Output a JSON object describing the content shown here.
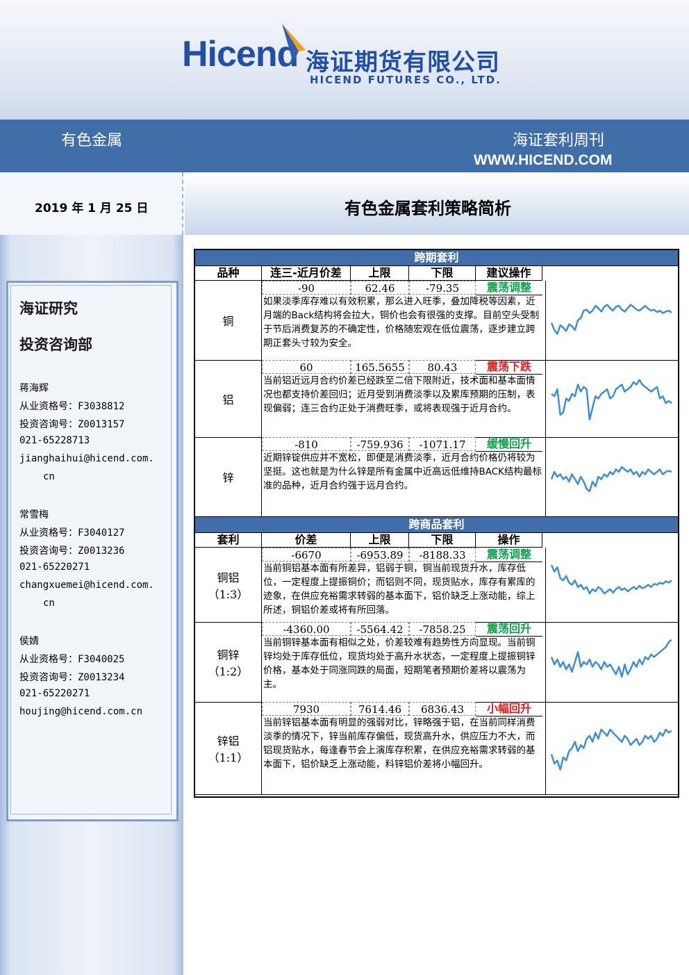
{
  "header": {
    "logo_text": "Hicend",
    "company_cn": "海证期货有限公司",
    "company_en": "HICEND  FUTURES  CO.,  LTD.",
    "section": "有色金属",
    "publication": "海证套利周刊",
    "url": "WWW.HICEND.COM"
  },
  "date": "2019 年 1 月 25 日",
  "doc_title": "有色金属套利策略简析",
  "sidebar": {
    "dept_line1": "海证研究",
    "dept_line2": "投资咨询部",
    "analysts": [
      {
        "name": "蒋海辉",
        "qual": "从业资格号：F3038812",
        "invest": "投资咨询号：Z0013157",
        "phone": "021-65228713",
        "email": "jianghaihui@hicend.com.",
        "email2": "cn"
      },
      {
        "name": "常雪梅",
        "qual": "从业资格号：F3040127",
        "invest": "投资咨询号：Z0013236",
        "phone": "021-65220271",
        "email": "changxuemei@hicend.com.",
        "email2": "cn"
      },
      {
        "name": "侯婧",
        "qual": "从业资格号：F3040025",
        "invest": "投资咨询号：Z0013234",
        "phone": "021-65220271",
        "email": "houjing@hicend.com.cn",
        "email2": ""
      }
    ]
  },
  "colors": {
    "accent": "#3f6ea8",
    "green": "#0aa34a",
    "red": "#e21b1b",
    "line": "#3a8fd6"
  },
  "table": {
    "section1": "跨期套利",
    "headers1": [
      "品种",
      "连三-近月价差",
      "上限",
      "下限",
      "建议操作"
    ],
    "section2": "跨商品套利",
    "headers2": [
      "套利",
      "价差",
      "上限",
      "下限",
      "操作"
    ],
    "rows1": [
      {
        "name": "铜",
        "name2": "",
        "spread": "-90",
        "upper": "62.46",
        "lower": "-79.35",
        "op": "震荡调整",
        "op_color": "green",
        "desc": "如果淡季库存难以有效积累，那么进入旺季，叠加降税等因素，近月端的Back结构将会拉大，铜价也会有很强的支撑。目前空头受制于节后消费复苏的不确定性，价格随宏观在低位震荡，逐步建立跨期正套头寸较为安全。",
        "trend": [
          0.55,
          0.7,
          0.78,
          0.6,
          0.65,
          0.72,
          0.58,
          0.62,
          0.7,
          0.5,
          0.45,
          0.3,
          0.28,
          0.35,
          0.3,
          0.2,
          0.25,
          0.32,
          0.22,
          0.18,
          0.25,
          0.3,
          0.22,
          0.2,
          0.28,
          0.32,
          0.25,
          0.18,
          0.22,
          0.28,
          0.3,
          0.25,
          0.2,
          0.26,
          0.3,
          0.28,
          0.33,
          0.3,
          0.35,
          0.32,
          0.3,
          0.34
        ]
      },
      {
        "name": "铝",
        "name2": "",
        "spread": "60",
        "upper": "165.5655",
        "lower": "80.43",
        "op": "震荡下跌",
        "op_color": "red",
        "desc": "当前铝近远月合约价差已经跌至二倍下限附近，技术面和基本面情况也都支持价差回归；近月受到消费淡季以及累库预期的压制，表现偏弱；连三合约正处于消费旺季，或将表现强于近月合约。",
        "trend": [
          0.4,
          0.45,
          0.3,
          0.85,
          0.8,
          0.5,
          0.55,
          0.4,
          0.45,
          0.2,
          0.35,
          0.25,
          0.3,
          0.95,
          0.7,
          0.45,
          0.5,
          0.4,
          0.35,
          0.3,
          0.5,
          0.45,
          0.3,
          0.25,
          0.2,
          0.35,
          0.3,
          0.25,
          0.15,
          0.2,
          0.1,
          0.2,
          0.25,
          0.3,
          0.35,
          0.3,
          0.25,
          0.5,
          0.45,
          0.6,
          0.55,
          0.6
        ]
      },
      {
        "name": "锌",
        "name2": "",
        "spread": "-810",
        "upper": "-759.936",
        "lower": "-1071.17",
        "op": "缓慢回升",
        "op_color": "green",
        "desc": "近期锌锭供应并不宽松，即便是消费淡季，近月合约价格仍将较为坚挺。这也就是为什么锌是所有金属中近高远低维持BACK结构最标准的品种，近月合约强于远月合约。",
        "trend": [
          0.55,
          0.4,
          0.5,
          0.45,
          0.55,
          0.5,
          0.6,
          0.45,
          0.55,
          0.65,
          0.5,
          0.6,
          0.75,
          0.8,
          0.6,
          0.7,
          0.5,
          0.55,
          0.45,
          0.5,
          0.4,
          0.45,
          0.35,
          0.4,
          0.3,
          0.35,
          0.4,
          0.35,
          0.45,
          0.4,
          0.5,
          0.4,
          0.45,
          0.35,
          0.4,
          0.45,
          0.4,
          0.35,
          0.45,
          0.4,
          0.38,
          0.4
        ]
      }
    ],
    "rows2": [
      {
        "name": "铜铝",
        "name2": "（1:3）",
        "spread": "-6670",
        "upper": "-6953.89",
        "lower": "-8188.33",
        "op": "震荡调整",
        "op_color": "green",
        "desc": "当前铜铝基本面有所差异，铝弱于铜，铜当前现货升水，库存低位，一定程度上提振铜价；而铝则不同，现货贴水，库存有累库的迹象，在供应充裕需求转弱的基本面下，铝价缺乏上涨动能，综上所述，铜铝价差或将有所回落。",
        "trend": [
          0.05,
          0.2,
          0.1,
          0.35,
          0.4,
          0.3,
          0.45,
          0.5,
          0.4,
          0.55,
          0.5,
          0.6,
          0.55,
          0.7,
          0.6,
          0.65,
          0.55,
          0.6,
          0.7,
          0.65,
          0.6,
          0.68,
          0.6,
          0.55,
          0.62,
          0.58,
          0.65,
          0.6,
          0.55,
          0.6,
          0.52,
          0.58,
          0.55,
          0.5,
          0.55,
          0.48,
          0.5,
          0.45,
          0.48,
          0.42,
          0.45,
          0.4
        ]
      },
      {
        "name": "铜锌",
        "name2": "（1:2）",
        "spread": "-4360.00",
        "upper": "-5564.42",
        "lower": "-7858.25",
        "op": "震荡回升",
        "op_color": "green",
        "desc": "当前铜锌基本面有相似之处，价差较难有趋势性方向显现。当前铜锌均处于库存低位，现货均处于高升水状态，一定程度上提振铜锌价格，基本处于同涨同跌的局面，短期笔者预期价差将以震荡为主。",
        "trend": [
          0.4,
          0.55,
          0.45,
          0.6,
          0.5,
          0.65,
          0.55,
          0.7,
          0.5,
          0.3,
          0.6,
          0.5,
          0.55,
          0.45,
          0.6,
          0.5,
          0.55,
          0.65,
          0.5,
          0.6,
          0.55,
          0.65,
          0.75,
          0.6,
          0.8,
          0.55,
          0.75,
          0.65,
          0.5,
          0.6,
          0.45,
          0.55,
          0.4,
          0.45,
          0.35,
          0.4,
          0.35,
          0.3,
          0.25,
          0.2,
          0.1,
          0.05
        ]
      },
      {
        "name": "锌铝",
        "name2": "（1:1）",
        "spread": "7930",
        "upper": "7614.46",
        "lower": "6836.43",
        "op": "小幅回升",
        "op_color": "red",
        "desc": "当前锌铝基本面有明显的强弱对比，锌略强于铝，在当前同样消费淡季的情况下，锌当前库存偏低，现货高升水，供应压力不大，而铝现货贴水，每逢春节会上演库存积累，在供应充裕需求转弱的基本面下，铝价缺乏上涨动能，料锌铝价差将小幅回升。",
        "trend": [
          0.6,
          0.75,
          0.7,
          0.85,
          0.65,
          0.7,
          0.55,
          0.5,
          0.4,
          0.55,
          0.45,
          0.5,
          0.35,
          0.3,
          0.4,
          0.25,
          0.35,
          0.2,
          0.25,
          0.3,
          0.2,
          0.25,
          0.3,
          0.35,
          0.4,
          0.3,
          0.35,
          0.45,
          0.4,
          0.35,
          0.45,
          0.4,
          0.3,
          0.35,
          0.3,
          0.4,
          0.35,
          0.25,
          0.3,
          0.2,
          0.25,
          0.22
        ]
      }
    ]
  }
}
